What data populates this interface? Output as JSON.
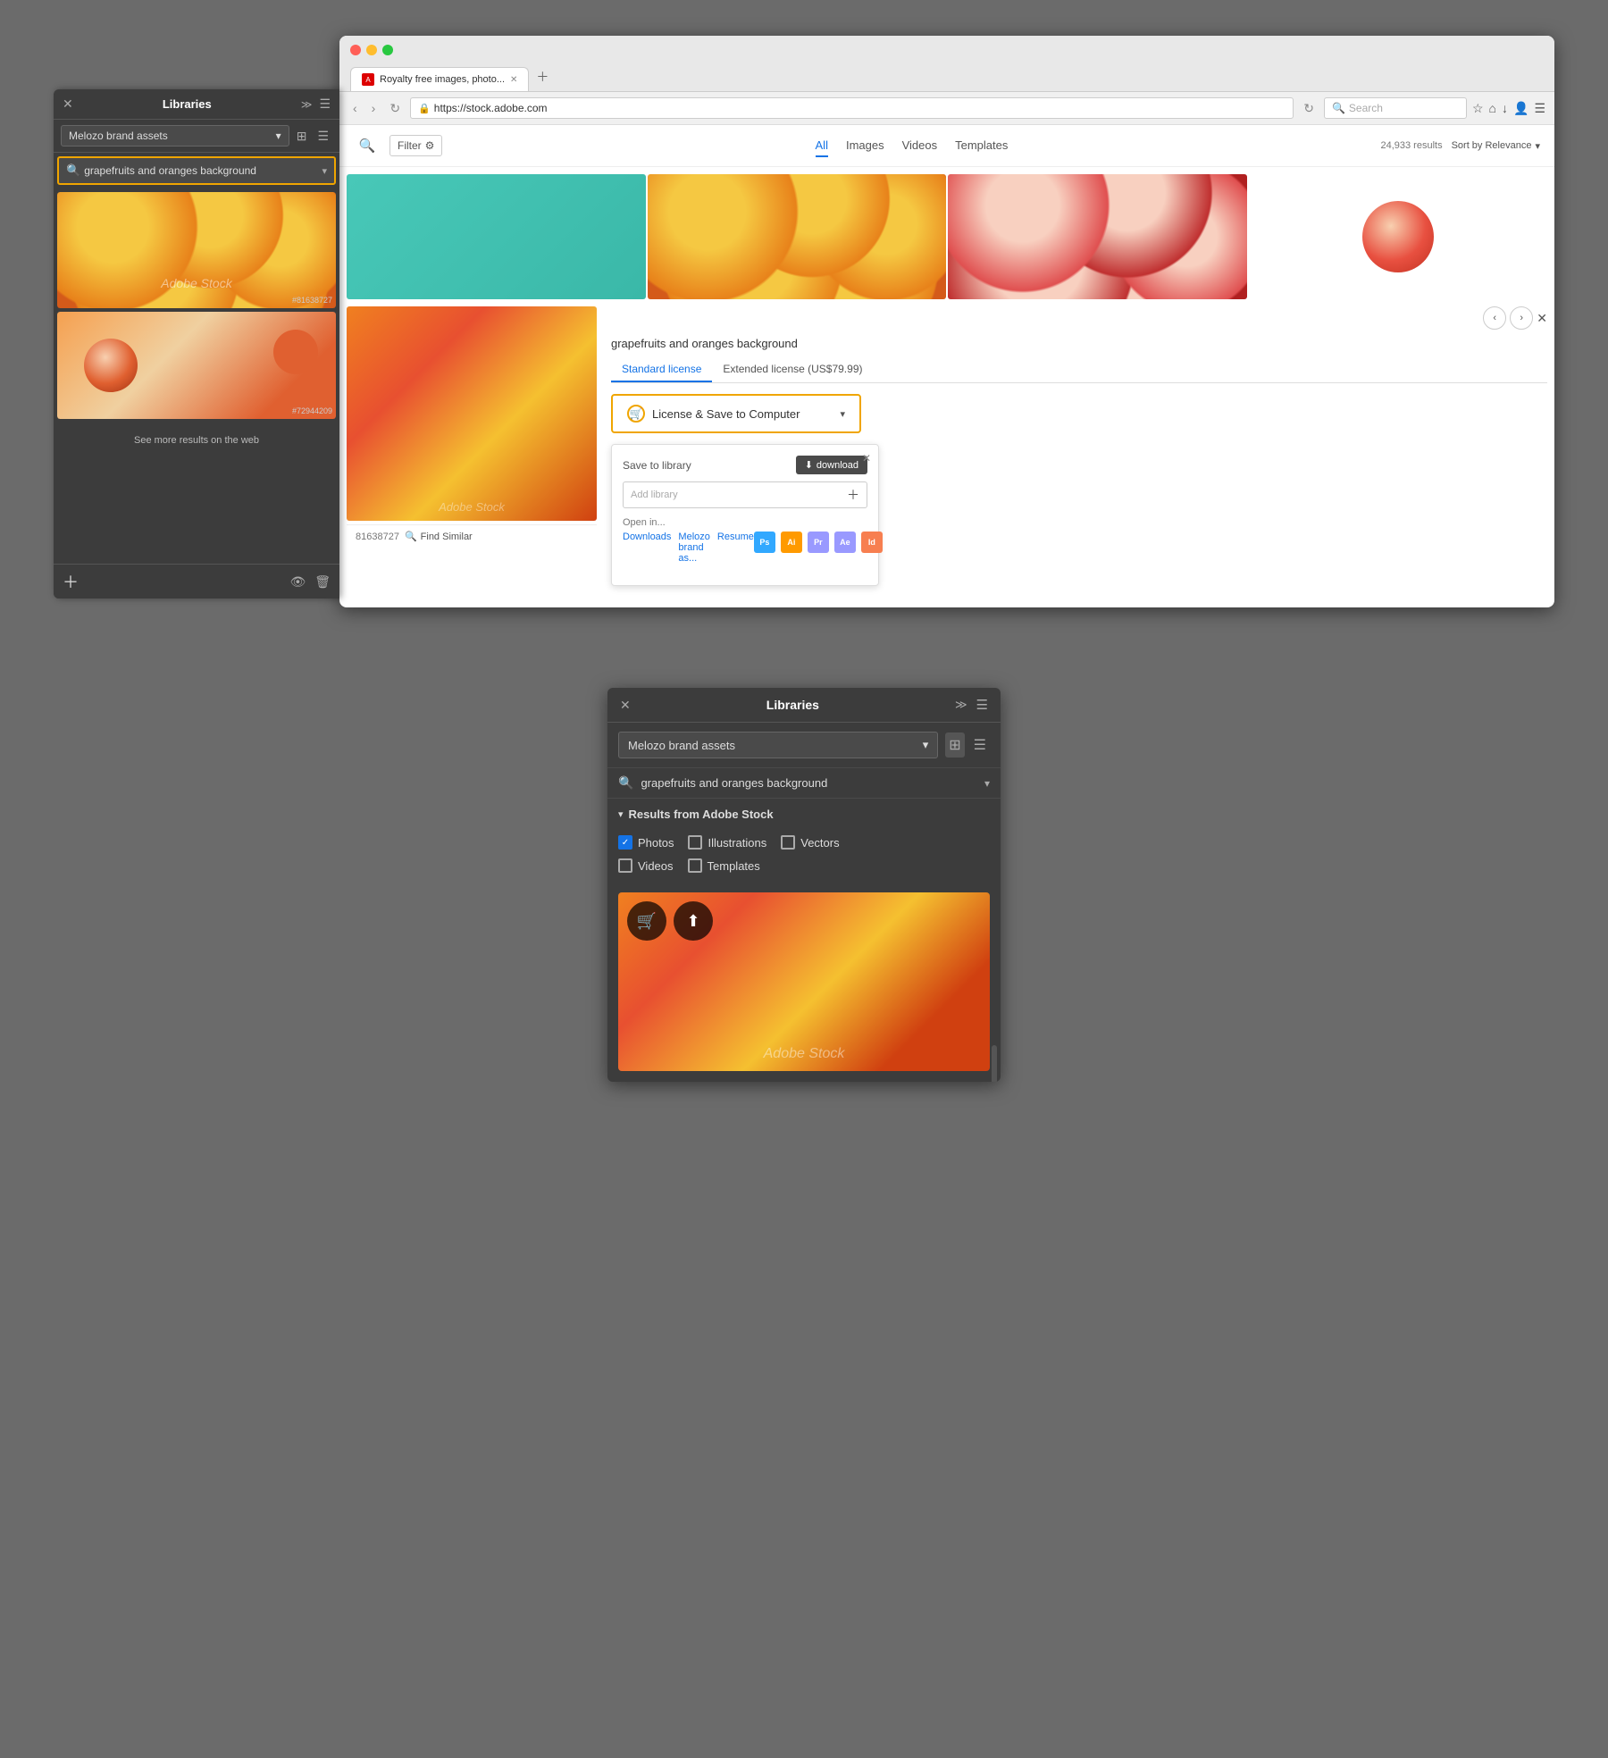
{
  "top": {
    "libraries_panel": {
      "title": "Libraries",
      "dropdown_value": "Melozo brand assets",
      "search_query": "grapefruits and oranges background",
      "see_more_text": "See more results on the web",
      "image_ids": [
        "#81638727",
        "#72944209"
      ],
      "watermark": "Adobe Stock"
    },
    "browser": {
      "tab_title": "Royalty free images, photo...",
      "url": "https://stock.adobe.com",
      "search_placeholder": "Search"
    },
    "stock": {
      "filter_label": "Filter",
      "tabs": [
        "All",
        "Images",
        "Videos",
        "Templates"
      ],
      "active_tab": "All",
      "results_count": "24,933 results",
      "sort_label": "Sort by Relevance",
      "title": "grapefruits and oranges background",
      "image_id": "81638727",
      "license_tabs": [
        "Standard license",
        "Extended license (US$79.99)"
      ],
      "license_btn_text": "License & Save to  Computer",
      "save_to_library_label": "Save to library",
      "download_btn_text": "download",
      "add_library_placeholder": "Add library",
      "open_in_label": "Open in...",
      "open_in_links": [
        "Downloads",
        "Melozo brand as...",
        "Resume"
      ],
      "find_similar_text": "Find Similar",
      "apps": [
        "Ps",
        "Ai",
        "Pr",
        "Ae",
        "Id"
      ]
    }
  },
  "bottom": {
    "libraries_panel": {
      "title": "Libraries",
      "dropdown_value": "Melozo brand assets",
      "search_query": "grapefruits and oranges background",
      "section_title": "Results from Adobe Stock",
      "filters": {
        "row1": [
          "Photos",
          "Illustrations",
          "Vectors"
        ],
        "row2": [
          "Videos",
          "Templates"
        ],
        "checked": [
          "Photos"
        ]
      },
      "watermark": "Adobe Stock",
      "image_title": "grapefruits and oranges background"
    }
  }
}
